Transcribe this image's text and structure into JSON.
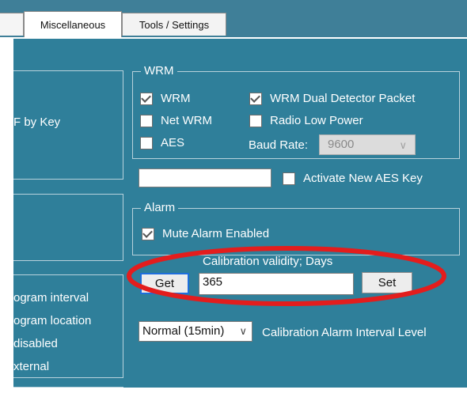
{
  "tabs": [
    {
      "label": ""
    },
    {
      "label": "Miscellaneous"
    },
    {
      "label": "Tools / Settings"
    }
  ],
  "left_panel": {
    "top_group_text": "F by Key",
    "bottom_group_lines": [
      "ogram interval",
      "ogram location",
      "disabled",
      "xternal"
    ]
  },
  "wrm": {
    "legend": "WRM",
    "items": [
      {
        "label": "WRM",
        "checked": true
      },
      {
        "label": "WRM Dual Detector Packet",
        "checked": true
      },
      {
        "label": "Net WRM",
        "checked": false
      },
      {
        "label": "Radio Low Power",
        "checked": false
      },
      {
        "label": "AES",
        "checked": false
      }
    ],
    "baud_rate_label": "Baud Rate:",
    "baud_rate_value": "9600"
  },
  "aes": {
    "key_value": "",
    "activate_label": "Activate New AES Key",
    "activate_checked": false
  },
  "alarm": {
    "legend": "Alarm",
    "mute_label": "Mute Alarm Enabled",
    "mute_checked": true
  },
  "calibration": {
    "label": "Calibration validity; Days",
    "get_label": "Get",
    "value": "365",
    "set_label": "Set"
  },
  "interval": {
    "selected": "Normal (15min)",
    "label": "Calibration Alarm Interval Level"
  },
  "colors": {
    "panel_background": "#2f7f9a",
    "tab_strip": "#3f7f98",
    "highlight_ellipse": "#e31d1d",
    "get_button_border": "#1e6fdc"
  }
}
